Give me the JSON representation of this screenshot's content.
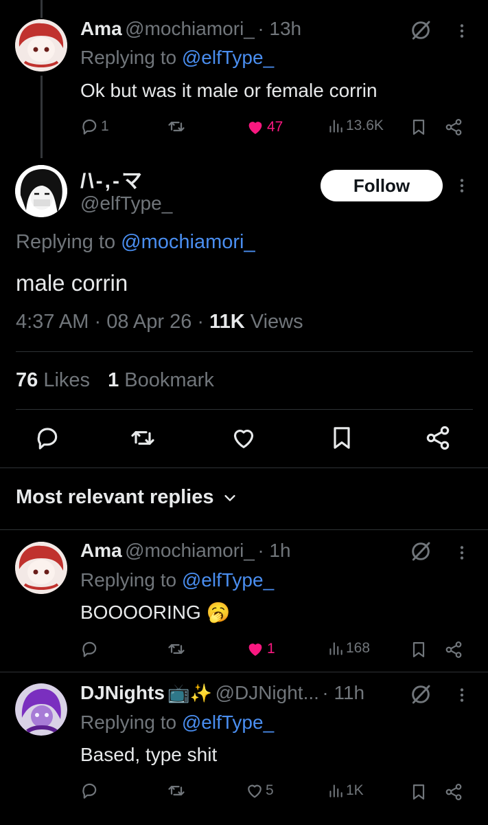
{
  "colors": {
    "background": "#000000",
    "text": "#e7e9ea",
    "muted": "#71767b",
    "link": "#4a8ef0",
    "like": "#f91880"
  },
  "parent_reply": {
    "name": "Ama",
    "handle": "@mochiamori_",
    "time": "· 13h",
    "replying_to_label": "Replying to",
    "replying_to_handle": "@elfType_",
    "text": "Ok but was it male or female corrin",
    "replies": "1",
    "likes": "47",
    "views": "13.6K",
    "liked": true
  },
  "main_tweet": {
    "name": "/\\-,-マ",
    "handle": "@elfType_",
    "follow_label": "Follow",
    "replying_to_label": "Replying to",
    "replying_to_handle": "@mochiamori_",
    "text": "male corrin",
    "time": "4:37 AM",
    "date": "08 Apr 26",
    "views_count": "11K",
    "views_label": "Views",
    "likes_count": "76",
    "likes_label": "Likes",
    "bookmarks_count": "1",
    "bookmarks_label": "Bookmark"
  },
  "sort_label": "Most relevant replies",
  "replies": [
    {
      "name": "Ama",
      "handle": "@mochiamori_",
      "time": "· 1h",
      "replying_to_label": "Replying to",
      "replying_to_handle": "@elfType_",
      "text": "BOOOORING",
      "emoji": "🥱",
      "replies": "",
      "likes": "1",
      "views": "168",
      "liked": true
    },
    {
      "name": "DJNights",
      "name_emoji": "📺✨",
      "handle": "@DJNight...",
      "time": "· 11h",
      "replying_to_label": "Replying to",
      "replying_to_handle": "@elfType_",
      "text": "Based, type shit",
      "replies": "",
      "likes": "5",
      "views": "1K",
      "liked": false
    }
  ]
}
